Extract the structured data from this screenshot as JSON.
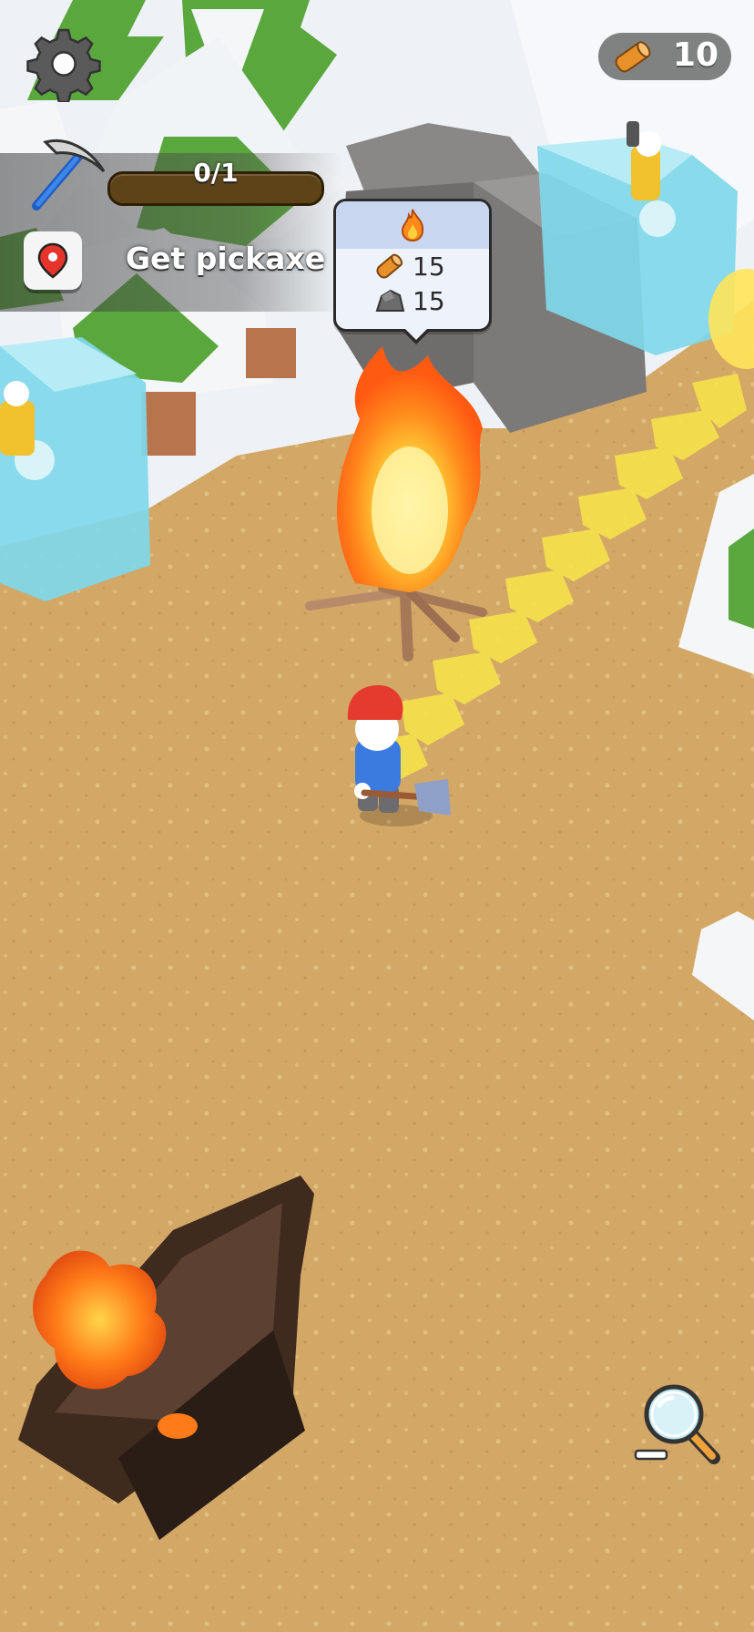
{
  "hud": {
    "wood_count": "10",
    "quest": {
      "progress_text": "0/1",
      "progress_fraction": 0,
      "label": "Get pickaxe"
    },
    "build_cost": {
      "wood": "15",
      "stone": "15"
    }
  },
  "icons": {
    "settings": "gear-icon",
    "wood": "log-icon",
    "stone": "stone-icon",
    "campfire": "flame-icon",
    "quest_tool": "pickaxe-icon",
    "location": "map-pin-icon",
    "zoom": "magnifier-minus-icon"
  },
  "colors": {
    "ground": "#d3a766",
    "snow": "#f1f4f8",
    "pine": "#5aa73d",
    "ice": "#7fd8ea",
    "rock": "#7c7a78",
    "arrow_trail": "#f6e24c",
    "player_hat": "#e53a2e",
    "player_jacket": "#3b7be0"
  }
}
